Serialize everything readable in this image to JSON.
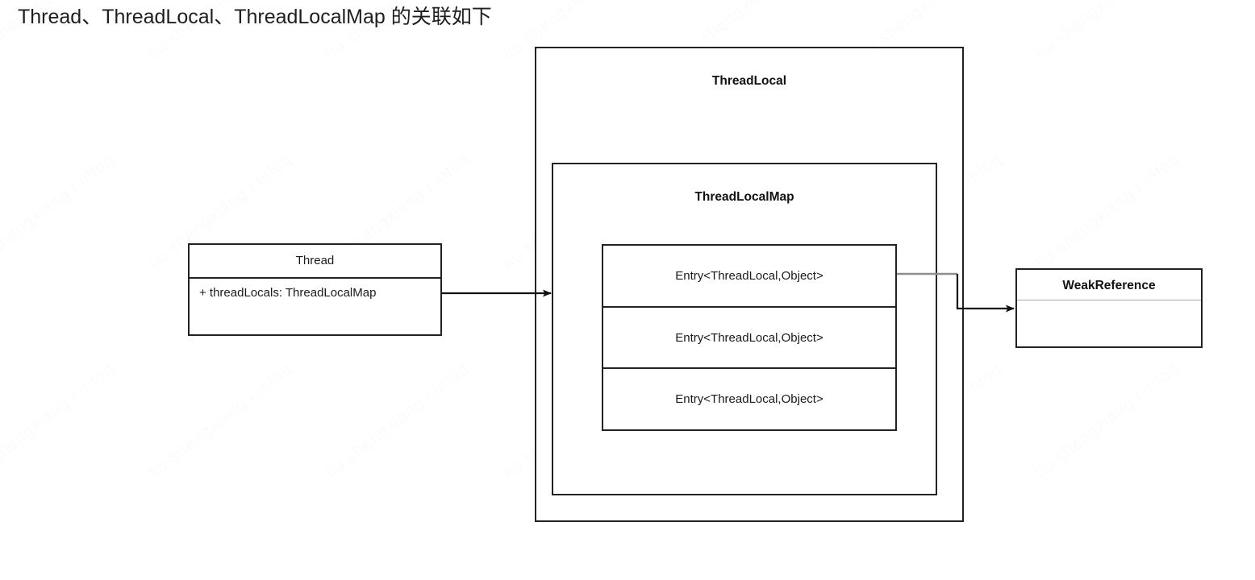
{
  "page": {
    "title": "Thread、ThreadLocal、ThreadLocalMap 的关联如下"
  },
  "diagram": {
    "type": "uml-class-relationship",
    "thread_class": {
      "name": "Thread",
      "attributes": [
        "+ threadLocals: ThreadLocalMap"
      ]
    },
    "threadlocal_container": {
      "name": "ThreadLocal"
    },
    "threadlocalmap_container": {
      "name": "ThreadLocalMap"
    },
    "entries": [
      {
        "label": "Entry<ThreadLocal,Object>"
      },
      {
        "label": "Entry<ThreadLocal,Object>"
      },
      {
        "label": "Entry<ThreadLocal,Object>"
      }
    ],
    "weakreference_class": {
      "name": "WeakReference",
      "attributes": []
    },
    "connectors": [
      {
        "name": "thread-to-threadlocal",
        "from": "Thread",
        "to": "ThreadLocal",
        "style": "solid-arrow"
      },
      {
        "name": "entry-to-weakreference",
        "from": "Entry<ThreadLocal,Object>",
        "to": "WeakReference",
        "style": "solid-elbow-arrow"
      }
    ],
    "colors": {
      "stroke": "#222222",
      "light_stroke": "#a8a8a8",
      "background": "#ffffff",
      "text": "#1a1a1a"
    }
  },
  "watermark": {
    "text": "liu shengxiang i.infoq"
  }
}
